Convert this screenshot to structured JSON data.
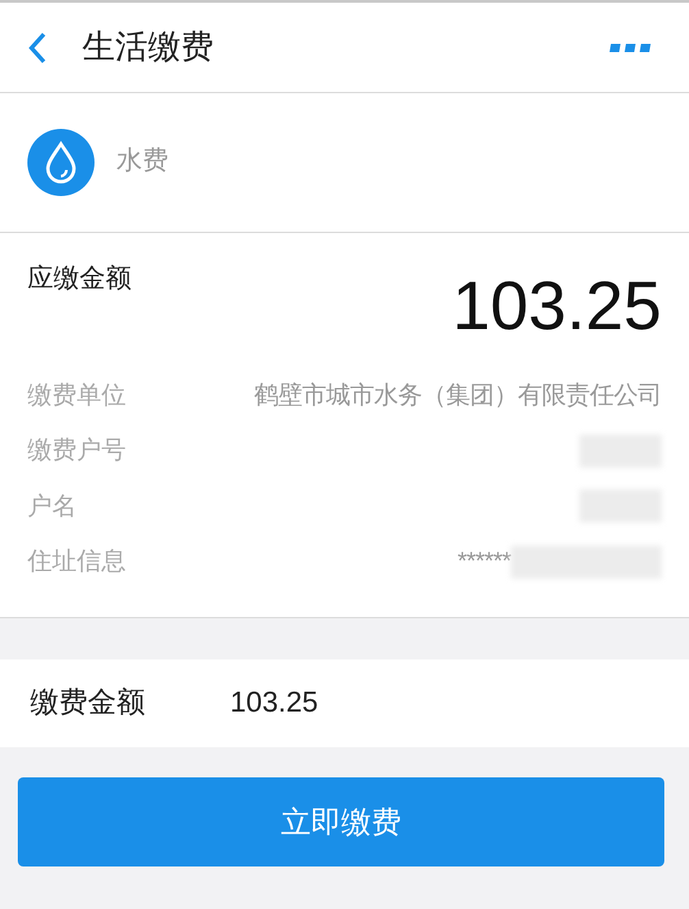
{
  "header": {
    "title": "生活缴费"
  },
  "service": {
    "name": "水费"
  },
  "amount_due": {
    "label": "应缴金额",
    "value": "103.25"
  },
  "details": [
    {
      "label": "缴费单位",
      "value": "鹤壁市城市水务（集团）有限责任公司",
      "redacted": false
    },
    {
      "label": "缴费户号",
      "redacted": true
    },
    {
      "label": "户名",
      "redacted": true
    },
    {
      "label": "住址信息",
      "value": "******",
      "redacted": true
    }
  ],
  "payment": {
    "label": "缴费金额",
    "value": "103.25"
  },
  "submit_button": "立即缴费"
}
